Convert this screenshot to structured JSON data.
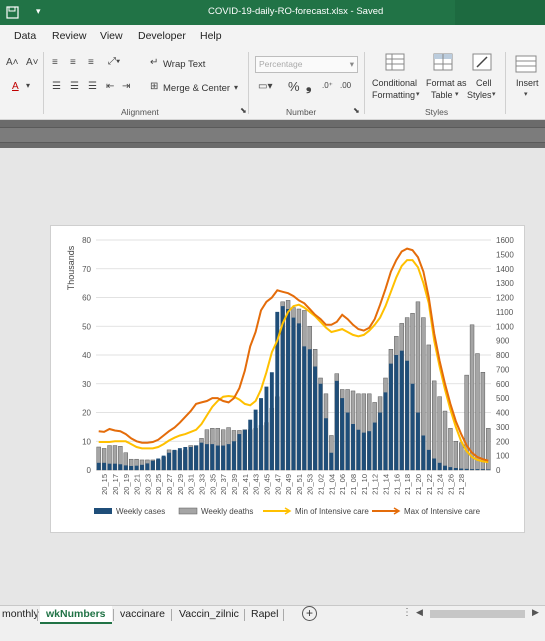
{
  "window": {
    "title": "COVID-19-daily-RO-forecast.xlsx  -  Saved"
  },
  "menu": [
    "Data",
    "Review",
    "View",
    "Developer",
    "Help"
  ],
  "ribbon": {
    "wrap_text": "Wrap Text",
    "merge_center": "Merge & Center",
    "alignment_label": "Alignment",
    "number_format": "Percentage",
    "number_label": "Number",
    "cond_format_1": "Conditional",
    "cond_format_2": "Formatting",
    "format_table_1": "Format as",
    "format_table_2": "Table",
    "cell_styles_1": "Cell",
    "cell_styles_2": "Styles",
    "styles_label": "Styles",
    "insert_label": "Insert",
    "percent_symbol": "%",
    "comma_symbol": "❟"
  },
  "sheet_tabs": {
    "items": [
      "monthly",
      "wkNumbers",
      "vaccinare",
      "Vaccin_zilnic",
      "Rapel"
    ],
    "active": "wkNumbers"
  },
  "chart_data": {
    "type": "bar",
    "title": "",
    "ylabel_left": "Thousands",
    "ylim_left": [
      0,
      80
    ],
    "yticks_left": [
      0,
      10,
      20,
      30,
      40,
      50,
      60,
      70,
      80
    ],
    "ylim_right": [
      0,
      1600
    ],
    "yticks_right": [
      0,
      100,
      200,
      300,
      400,
      500,
      600,
      700,
      800,
      900,
      1000,
      1100,
      1200,
      1300,
      1400,
      1500,
      1600
    ],
    "grid": true,
    "legend_position": "bottom",
    "x_tick_labels": [
      "20_15",
      "20_17",
      "20_19",
      "20_21",
      "20_23",
      "20_25",
      "20_27",
      "20_29",
      "20_31",
      "20_33",
      "20_35",
      "20_37",
      "20_39",
      "20_41",
      "20_43",
      "20_45",
      "20_47",
      "20_49",
      "20_51",
      "20_53",
      "21_02",
      "21_04",
      "21_06",
      "21_08",
      "21_10",
      "21_12",
      "21_14",
      "21_16",
      "21_18",
      "21_20",
      "21_22",
      "21_24",
      "21_26",
      "21_28"
    ],
    "weekly_cases": [
      2.5,
      2.5,
      2.2,
      2.2,
      2.0,
      1.6,
      1.4,
      1.5,
      1.8,
      2.3,
      3.2,
      4.0,
      5.0,
      6.0,
      7.0,
      7.6,
      8.0,
      8.0,
      8.5,
      9.5,
      9.0,
      9.0,
      8.5,
      8.5,
      9.0,
      10.0,
      12.5,
      14.0,
      17.5,
      21.0,
      25.0,
      29.0,
      34.0,
      55.0,
      57.0,
      56.0,
      53.0,
      51.0,
      43.0,
      42.0,
      36.0,
      30.0,
      18.0,
      6.0,
      31.0,
      25.0,
      20.0,
      16.0,
      14.0,
      13.0,
      13.5,
      16.5,
      20.0,
      27.0,
      37.0,
      40.0,
      41.5,
      38.0,
      30.0,
      20.0,
      12.0,
      7.0,
      4.0,
      2.5,
      1.5,
      1.0,
      0.7,
      0.5,
      0.4,
      0.3,
      0.3,
      0.3,
      0.2
    ],
    "weekly_deaths": [
      160,
      150,
      170,
      170,
      165,
      120,
      75,
      75,
      70,
      70,
      70,
      70,
      90,
      140,
      135,
      135,
      140,
      170,
      170,
      220,
      280,
      290,
      290,
      280,
      295,
      275,
      275,
      280,
      280,
      290,
      310,
      330,
      430,
      510,
      1170,
      1180,
      1130,
      1120,
      1110,
      1000,
      840,
      640,
      530,
      240,
      670,
      560,
      560,
      550,
      530,
      530,
      530,
      470,
      510,
      640,
      840,
      930,
      1020,
      1060,
      1090,
      1170,
      1060,
      870,
      620,
      510,
      410,
      290,
      200,
      190,
      660,
      1010,
      810,
      680,
      290
    ],
    "min_icu": [
      195,
      195,
      195,
      200,
      200,
      200,
      180,
      160,
      150,
      150,
      150,
      160,
      180,
      205,
      225,
      240,
      250,
      265,
      280,
      320,
      380,
      440,
      480,
      510,
      515,
      510,
      490,
      460,
      450,
      480,
      560,
      680,
      820,
      900,
      1020,
      1100,
      1140,
      1150,
      1130,
      1100,
      1070,
      1030,
      990,
      960,
      970,
      980,
      960,
      940,
      930,
      940,
      970,
      1010,
      1060,
      1140,
      1240,
      1340,
      1420,
      1460,
      1460,
      1410,
      1300,
      1160,
      900,
      720,
      560,
      420,
      300,
      200,
      130,
      90,
      70,
      60,
      55
    ],
    "max_icu": [
      270,
      265,
      285,
      275,
      270,
      250,
      220,
      200,
      190,
      190,
      195,
      210,
      240,
      270,
      295,
      330,
      370,
      410,
      460,
      470,
      480,
      500,
      500,
      480,
      470,
      500,
      570,
      690,
      860,
      960,
      1110,
      1170,
      1200,
      1250,
      1240,
      1230,
      1210,
      1180,
      1160,
      1120,
      1080,
      1050,
      1010,
      1010,
      1030,
      1080,
      1050,
      1010,
      980,
      970,
      990,
      1050,
      1150,
      1260,
      1380,
      1460,
      1520,
      1540,
      1530,
      1480,
      1380,
      1200,
      950,
      760,
      600,
      460,
      340,
      250,
      170,
      120,
      90,
      75,
      65
    ],
    "series": [
      {
        "name": "Weekly cases",
        "type": "bar",
        "axis": "left",
        "color": "#1f4e79"
      },
      {
        "name": "Weekly deaths",
        "type": "bar",
        "axis": "right",
        "color": "#a5a5a5"
      },
      {
        "name": "Min of Intensive care",
        "type": "line",
        "axis": "right",
        "color": "#ffc000"
      },
      {
        "name": "Max of Intensive care",
        "type": "line",
        "axis": "right",
        "color": "#e46c0a"
      }
    ]
  }
}
